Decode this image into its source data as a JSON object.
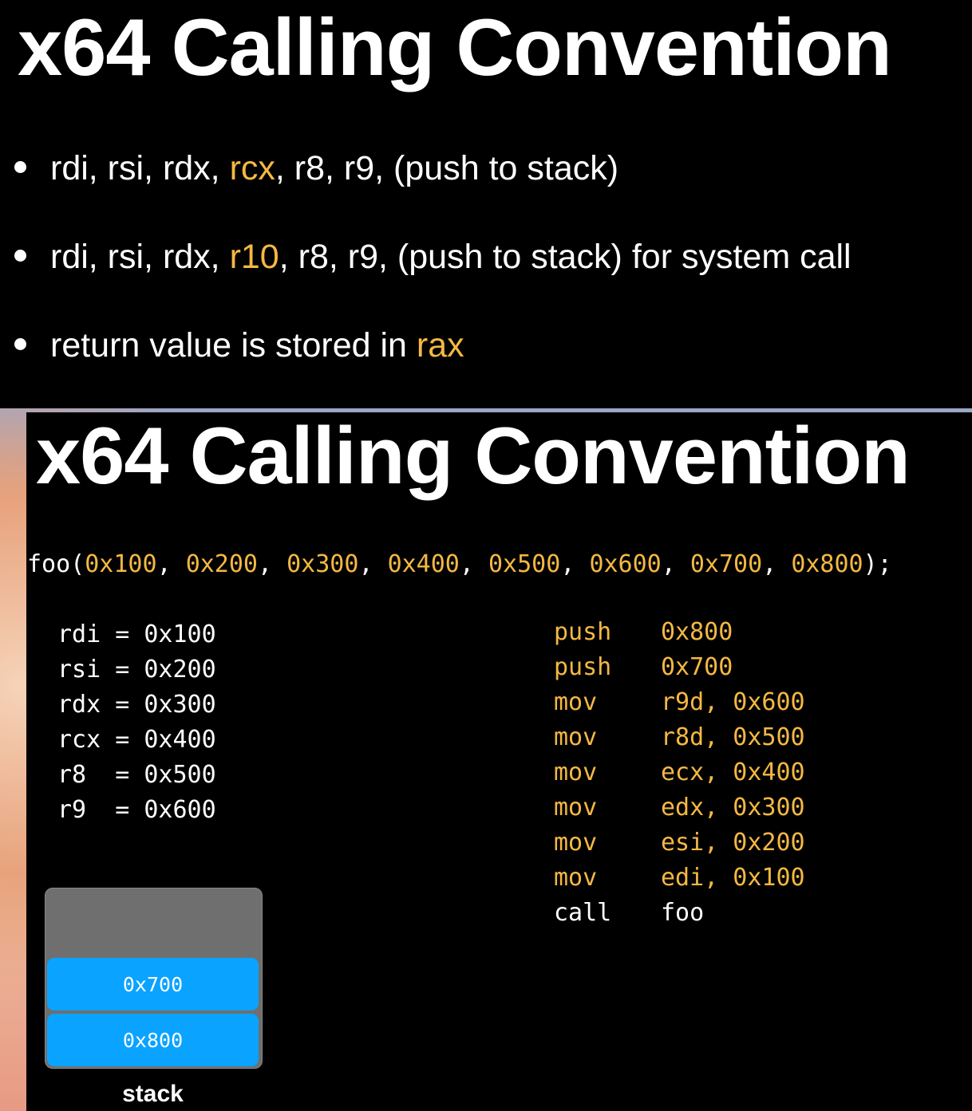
{
  "slide1": {
    "title": "x64 Calling Convention",
    "bullets": [
      {
        "before": "rdi, rsi, rdx, ",
        "highlight": "rcx",
        "after": ", r8, r9, (push to stack)"
      },
      {
        "before": "rdi, rsi, rdx, ",
        "highlight": "r10",
        "after": ", r8, r9, (push to stack) for system call"
      },
      {
        "before": "return value is stored in ",
        "highlight": "rax",
        "after": ""
      }
    ]
  },
  "slide2": {
    "title": "x64 Calling Convention",
    "call": {
      "func": "foo(",
      "args": [
        "0x100",
        "0x200",
        "0x300",
        "0x400",
        "0x500",
        "0x600",
        "0x700",
        "0x800"
      ],
      "sep": ", ",
      "end": ");"
    },
    "registers": [
      "rdi = 0x100",
      "rsi = 0x200",
      "rdx = 0x300",
      "rcx = 0x400",
      "r8  = 0x500",
      "r9  = 0x600"
    ],
    "asm": [
      {
        "op": "push",
        "args": "0x800"
      },
      {
        "op": "push",
        "args": "0x700"
      },
      {
        "op": "mov",
        "args": "r9d, 0x600"
      },
      {
        "op": "mov",
        "args": "r8d, 0x500"
      },
      {
        "op": "mov",
        "args": "ecx, 0x400"
      },
      {
        "op": "mov",
        "args": "edx, 0x300"
      },
      {
        "op": "mov",
        "args": "esi, 0x200"
      },
      {
        "op": "mov",
        "args": "edi, 0x100"
      },
      {
        "op": "call",
        "args": "foo"
      }
    ],
    "stack": {
      "items": [
        "0x700",
        "0x800"
      ],
      "label": "stack"
    }
  },
  "colors": {
    "highlight": "#f5b843",
    "stack_item": "#0aa3ff",
    "stack_box": "#6f6f6f"
  }
}
